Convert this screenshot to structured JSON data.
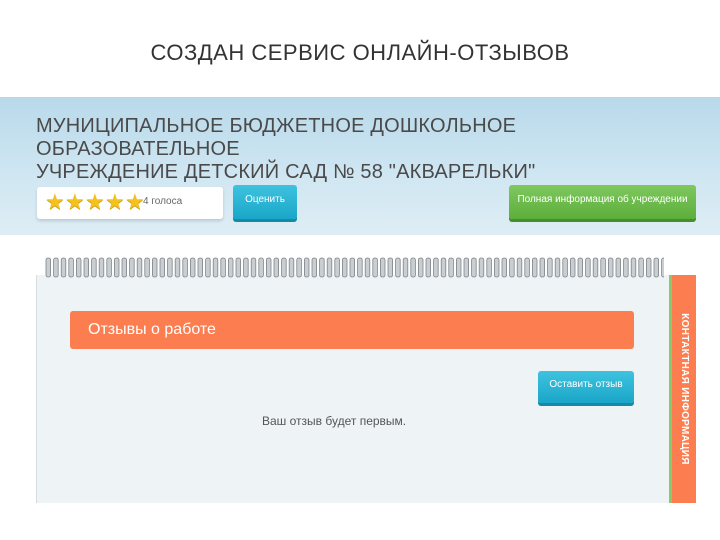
{
  "slide": {
    "title": "СОЗДАН СЕРВИС ОНЛАЙН-ОТЗЫВОВ"
  },
  "org": {
    "name_line1": "МУНИЦИПАЛЬНОЕ БЮДЖЕТНОЕ ДОШКОЛЬНОЕ ОБРАЗОВАТЕЛЬНОЕ",
    "name_line2": "УЧРЕЖДЕНИЕ ДЕТСКИЙ САД № 58 \"АКВАРЕЛЬКИ\""
  },
  "rating": {
    "stars": 5,
    "votes_label": "4 голоса",
    "rate_button": "Оценить"
  },
  "info_button": "Полная информация об учреждении",
  "reviews": {
    "title": "Отзывы о работе",
    "leave_button": "Оставить отзыв",
    "empty_text": "Ваш отзыв будет первым."
  },
  "side_tab": "КОНТАКТНАЯ ИНФОРМАЦИЯ",
  "colors": {
    "accent_orange": "#fb7d50",
    "button_blue": "#1aa6c8",
    "button_green": "#5cae3c",
    "star_yellow": "#f4c21b"
  }
}
